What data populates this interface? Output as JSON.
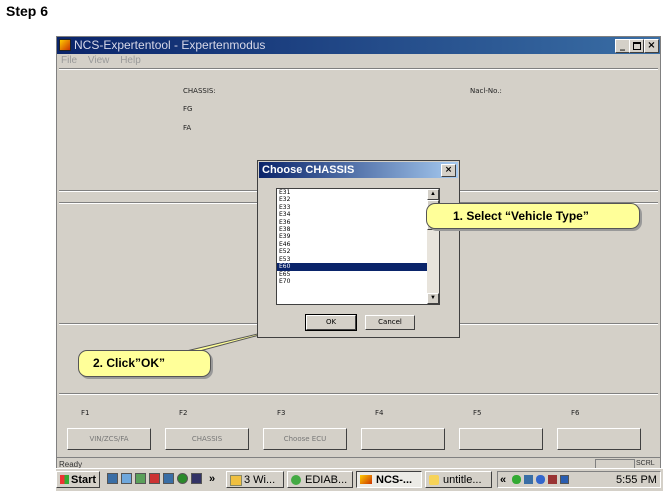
{
  "page": {
    "step_title": "Step 6"
  },
  "window": {
    "title": "NCS-Expertentool - Expertenmodus",
    "controls": {
      "minimize": "_",
      "restore": " ",
      "close": "×"
    }
  },
  "menu": [
    "File",
    "View",
    "Help"
  ],
  "header": {
    "chassis_label": "CHASSIS:",
    "fg_label": "FG",
    "fa_label": "FA",
    "nacl_label": "Nacl-No.:"
  },
  "function_keys": [
    {
      "key": "F1",
      "button": "VIN/ZCS/FA"
    },
    {
      "key": "F2",
      "button": "CHASSIS"
    },
    {
      "key": "F3",
      "button": "Choose ECU"
    },
    {
      "key": "F4",
      "button": ""
    },
    {
      "key": "F5",
      "button": ""
    },
    {
      "key": "F6",
      "button": ""
    }
  ],
  "status": {
    "text": "Ready",
    "right": "SCRL"
  },
  "dialog": {
    "title": "Choose CHASSIS",
    "close": "×",
    "items": [
      "E31",
      "E32",
      "E33",
      "E34",
      "E36",
      "E38",
      "E39",
      "E46",
      "E52",
      "E53",
      "E60",
      "E65",
      "E70"
    ],
    "selected": "E60",
    "ok": "OK",
    "cancel": "Cancel"
  },
  "callouts": {
    "select": "1. Select “Vehicle Type”",
    "click": "2. Click”OK”"
  },
  "taskbar": {
    "start": "Start",
    "more": "»",
    "items": [
      "3 Wi...",
      "EDIAB...",
      "NCS-...",
      "untitle..."
    ],
    "tray_more": "«",
    "clock": "5:55 PM"
  },
  "colors": {
    "selection": "#0a246a",
    "callout_bg": "#ffff99",
    "title_gradient_start": "#0a246a"
  }
}
